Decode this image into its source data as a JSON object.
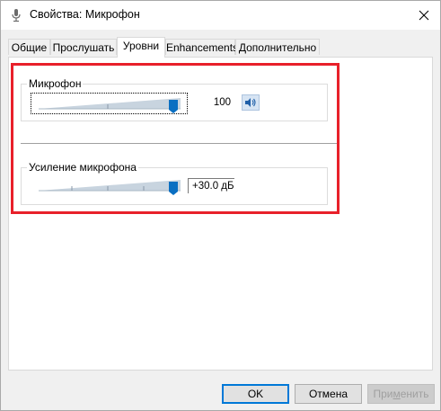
{
  "window": {
    "title": "Свойства: Микрофон",
    "close_icon": "close-icon"
  },
  "tabs": [
    {
      "label": "Общие",
      "active": false
    },
    {
      "label": "Прослушать",
      "active": false
    },
    {
      "label": "Уровни",
      "active": true
    },
    {
      "label": "Enhancements",
      "active": false
    },
    {
      "label": "Дополнительно",
      "active": false
    }
  ],
  "levels": {
    "microphone": {
      "label": "Микрофон",
      "value_text": "100",
      "level_fraction": 1.0,
      "speaker_icon": "speaker-icon"
    },
    "boost": {
      "label": "Усиление микрофона",
      "value_text": "+30.0 дБ",
      "level_fraction": 1.0
    }
  },
  "buttons": {
    "ok": "OK",
    "cancel": "Отмена",
    "apply_pre": "При",
    "apply_ul": "м",
    "apply_post": "енить"
  },
  "colors": {
    "highlight": "#e8202a",
    "thumb": "#0a6fc2",
    "track_fill": "#c8d4df"
  }
}
